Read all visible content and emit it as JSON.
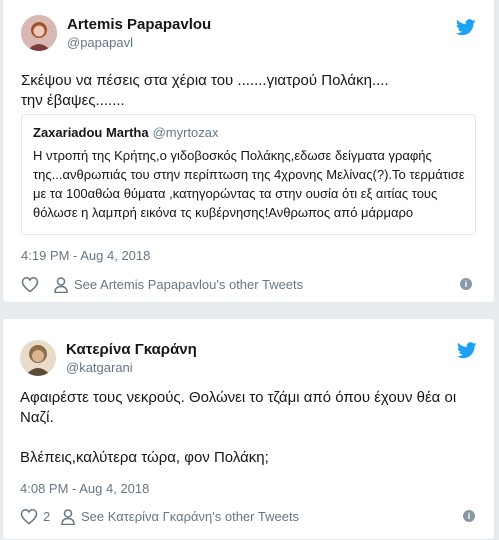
{
  "colors": {
    "twitter_blue": "#1da1f2",
    "secondary_text": "#657786",
    "border": "#e1e8ed"
  },
  "tweets": [
    {
      "author_name": "Artemis Papapavlou",
      "author_handle": "@papapavl",
      "text": "Σκέψου να πέσεις στα χέρια του .......γιατρού Πολάκη....\nτην έβαψες.......",
      "quote": {
        "author_name": "Zaxariadou Martha",
        "author_handle": "@myrtozax",
        "text": "Η ντροπή της Κρήτης,ο γιδοβοσκός Πολάκης,εδωσε δείγματα γραφής\nτης...ανθρωπιάς του στην περίπτωση της 4χρονης Μελίνας(?).Το τερμάτισε\nμε τα 100αθώα θύματα ,κατηγορώντας τα στην ουσία ότι εξ αιτίας τους\nθόλωσε η λαμπρή εικόνα τς κυβέρνησης!Ανθρωπος από μάρμαρο"
      },
      "timestamp": "4:19 PM - Aug 4, 2018",
      "likes": "",
      "see_other": "See Artemis Papapavlou's other Tweets",
      "icons": {
        "like": "heart-icon",
        "profile": "person-icon",
        "info": "info-icon",
        "brand": "twitter-bird-icon"
      }
    },
    {
      "author_name": "Κατερίνα Γκαράνη",
      "author_handle": "@katgarani",
      "text": "Αφαιρέστε τους νεκρούς. Θολώνει το τζάμι από όπου έχουν θέα οι\nΝαζί.\n\nΒλέπεις,καλύτερα τώρα, φον Πολάκη;",
      "timestamp": "4:08 PM - Aug 4, 2018",
      "likes": "2",
      "see_other": "See Κατερίνα Γκαράνη's other Tweets",
      "icons": {
        "like": "heart-icon",
        "profile": "person-icon",
        "info": "info-icon",
        "brand": "twitter-bird-icon"
      }
    }
  ]
}
